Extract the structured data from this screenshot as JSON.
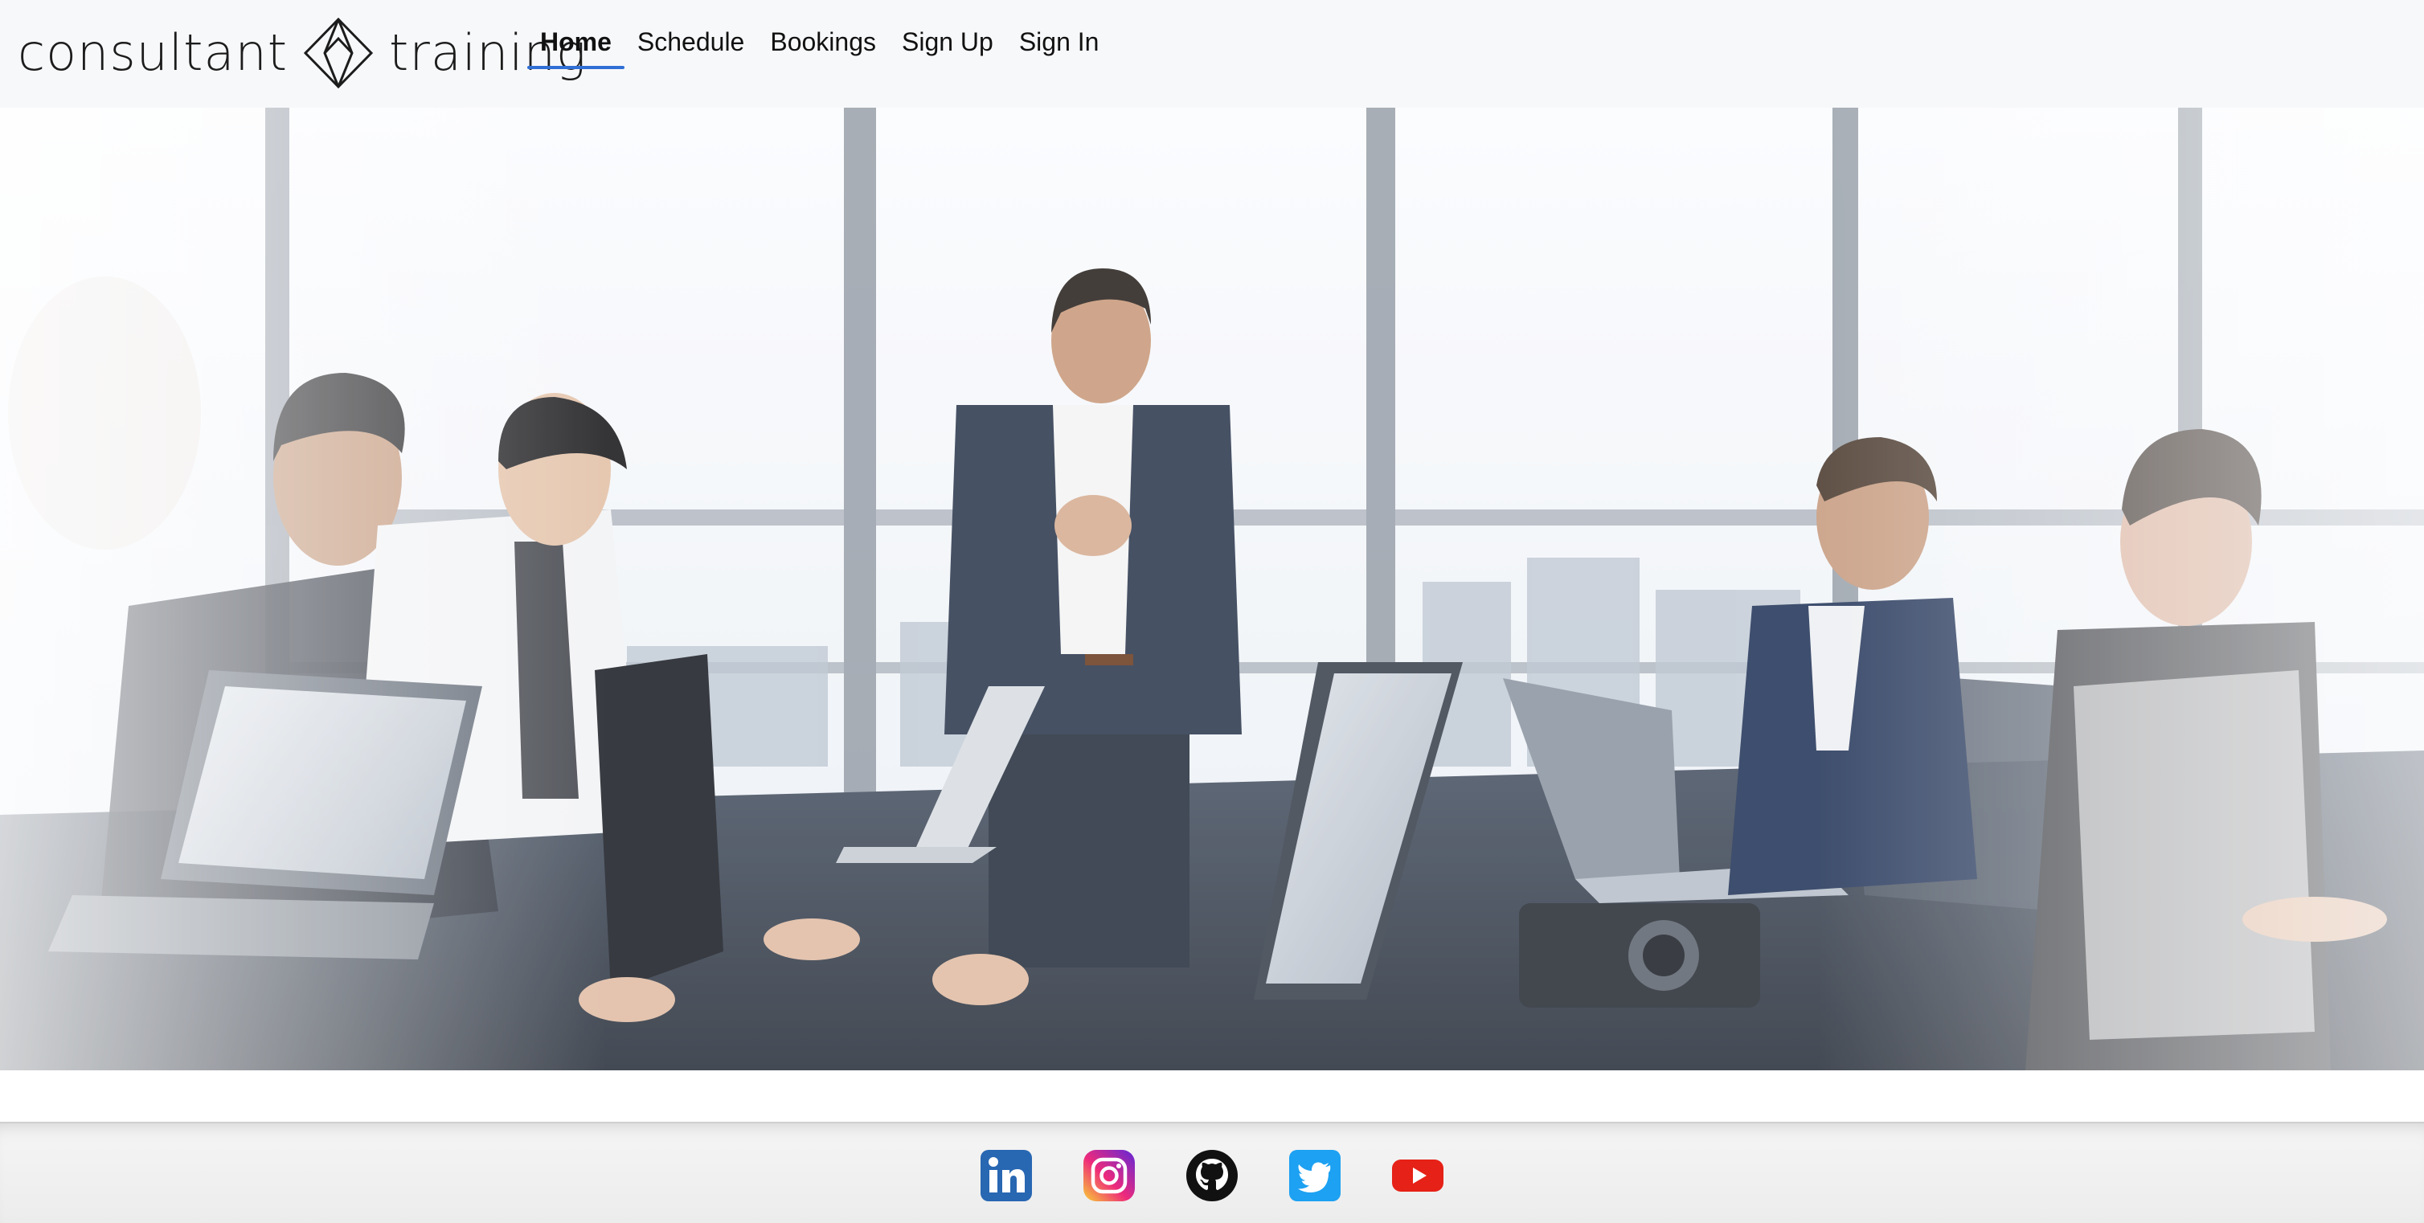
{
  "brand": {
    "word_left": "consultant",
    "word_right": "training",
    "logo_icon": "diamond-logo-icon"
  },
  "nav": {
    "items": [
      {
        "label": "Home",
        "active": true
      },
      {
        "label": "Schedule",
        "active": false
      },
      {
        "label": "Bookings",
        "active": false
      },
      {
        "label": "Sign Up",
        "active": false
      },
      {
        "label": "Sign In",
        "active": false
      }
    ],
    "active_color": "#2f6fd6"
  },
  "hero": {
    "image": "business-meeting-photo"
  },
  "footer": {
    "social": [
      {
        "name": "linkedin-icon",
        "color": "#2867b2"
      },
      {
        "name": "instagram-icon",
        "color": "#c13584"
      },
      {
        "name": "github-icon",
        "color": "#111111"
      },
      {
        "name": "twitter-icon",
        "color": "#1da1f2"
      },
      {
        "name": "youtube-icon",
        "color": "#e62117"
      }
    ]
  }
}
